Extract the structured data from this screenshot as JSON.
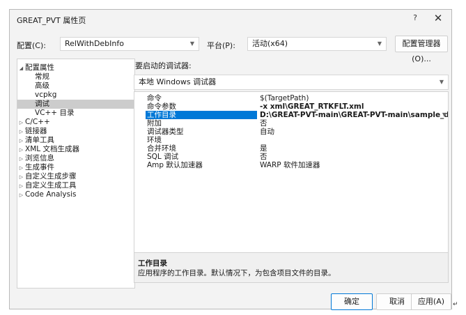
{
  "window": {
    "title": "GREAT_PVT 属性页",
    "help": "?",
    "close": "✕"
  },
  "toolbar": {
    "config_label": "配置(C):",
    "config_value": "RelWithDebInfo",
    "platform_label": "平台(P):",
    "platform_value": "活动(x64)",
    "config_manager": "配置管理器(O)..."
  },
  "tree": {
    "items": [
      {
        "label": "配置属性",
        "arrow": "◢",
        "indent": 0,
        "selected": false
      },
      {
        "label": "常规",
        "arrow": "",
        "indent": 1,
        "selected": false
      },
      {
        "label": "高级",
        "arrow": "",
        "indent": 1,
        "selected": false
      },
      {
        "label": "vcpkg",
        "arrow": "",
        "indent": 1,
        "selected": false
      },
      {
        "label": "调试",
        "arrow": "",
        "indent": 1,
        "selected": true
      },
      {
        "label": "VC++ 目录",
        "arrow": "",
        "indent": 1,
        "selected": false
      },
      {
        "label": "C/C++",
        "arrow": "▷",
        "indent": 0,
        "selected": false
      },
      {
        "label": "链接器",
        "arrow": "▷",
        "indent": 0,
        "selected": false
      },
      {
        "label": "清单工具",
        "arrow": "▷",
        "indent": 0,
        "selected": false
      },
      {
        "label": "XML 文档生成器",
        "arrow": "▷",
        "indent": 0,
        "selected": false
      },
      {
        "label": "浏览信息",
        "arrow": "▷",
        "indent": 0,
        "selected": false
      },
      {
        "label": "生成事件",
        "arrow": "▷",
        "indent": 0,
        "selected": false
      },
      {
        "label": "自定义生成步骤",
        "arrow": "▷",
        "indent": 0,
        "selected": false
      },
      {
        "label": "自定义生成工具",
        "arrow": "▷",
        "indent": 0,
        "selected": false
      },
      {
        "label": "Code Analysis",
        "arrow": "▷",
        "indent": 0,
        "selected": false
      }
    ]
  },
  "debugger": {
    "launch_label": "要启动的调试器:",
    "selected": "本地 Windows 调试器"
  },
  "properties": [
    {
      "name": "命令",
      "value": "$(TargetPath)",
      "bold": false,
      "selected": false
    },
    {
      "name": "命令参数",
      "value": "-x xml\\GREAT_RTKFLT.xml",
      "bold": true,
      "selected": false
    },
    {
      "name": "工作目录",
      "value": "D:\\GREAT-PVT-main\\GREAT-PVT-main\\sample_data\\",
      "bold": true,
      "selected": true
    },
    {
      "name": "附加",
      "value": "否",
      "bold": false,
      "selected": false
    },
    {
      "name": "调试器类型",
      "value": "自动",
      "bold": false,
      "selected": false
    },
    {
      "name": "环境",
      "value": "",
      "bold": false,
      "selected": false
    },
    {
      "name": "合并环境",
      "value": "是",
      "bold": false,
      "selected": false
    },
    {
      "name": "SQL 调试",
      "value": "否",
      "bold": false,
      "selected": false
    },
    {
      "name": "Amp 默认加速器",
      "value": "WARP 软件加速器",
      "bold": false,
      "selected": false
    }
  ],
  "description": {
    "title": "工作目录",
    "text": "应用程序的工作目录。默认情况下，为包含项目文件的目录。"
  },
  "buttons": {
    "ok": "确定",
    "cancel": "取消",
    "apply": "应用(A)"
  },
  "corner_mark": "↵",
  "colors": {
    "selection": "#0078d7",
    "tree_selection": "#cccccc"
  }
}
